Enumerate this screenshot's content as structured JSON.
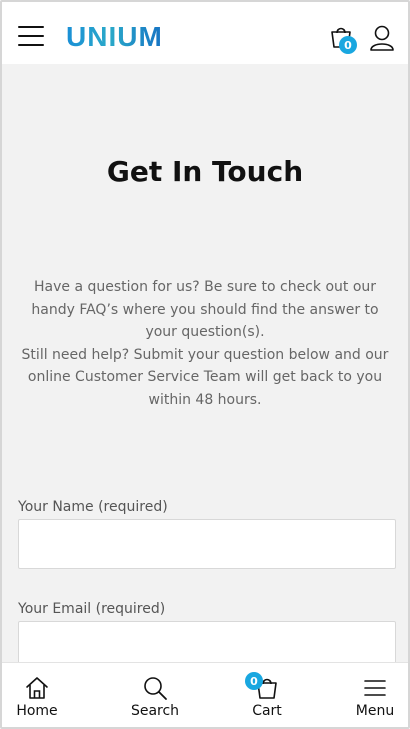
{
  "header": {
    "logo_text": "UNIUM",
    "cart_count": "0"
  },
  "main": {
    "title": "Get In Touch",
    "intro_line1": "Have a question for us? Be sure to check out our handy FAQ’s where you should find the answer to your question(s).",
    "intro_line2": "Still need help? Submit your question below and our online Customer Service Team will get back to you within 48 hours."
  },
  "form": {
    "name_label": "Your Name (required)",
    "name_value": "",
    "email_label": "Your Email (required)",
    "email_value": ""
  },
  "bottom_nav": {
    "items": [
      {
        "label": "Home",
        "icon": "home-icon"
      },
      {
        "label": "Search",
        "icon": "search-icon"
      },
      {
        "label": "Cart",
        "icon": "cart-icon",
        "badge": "0"
      },
      {
        "label": "Menu",
        "icon": "menu-icon"
      }
    ]
  },
  "colors": {
    "accent": "#19a7e0",
    "background": "#f2f2f2"
  }
}
